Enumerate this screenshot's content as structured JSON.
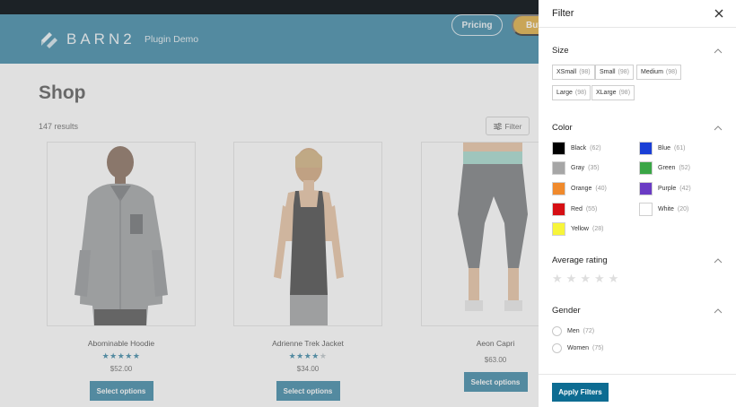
{
  "header": {
    "logo_text": "BARN2",
    "subtitle": "Plugin Demo",
    "pricing_label": "Pricing",
    "buy_label": "Buy"
  },
  "shop": {
    "title": "Shop",
    "results": "147 results",
    "filter_label": "Filter"
  },
  "products": [
    {
      "name": "Abominable Hoodie",
      "rating": 5,
      "price": "$52.00",
      "button": "Select options"
    },
    {
      "name": "Adrienne Trek Jacket",
      "rating": 4,
      "price": "$34.00",
      "button": "Select options"
    },
    {
      "name": "Aeon Capri",
      "rating": 0,
      "price": "$63.00",
      "button": "Select options"
    }
  ],
  "filter_drawer": {
    "title": "Filter",
    "size": {
      "title": "Size",
      "options": [
        {
          "label": "XSmall",
          "count": "(98)"
        },
        {
          "label": "Small",
          "count": "(98)"
        },
        {
          "label": "Medium",
          "count": "(98)"
        },
        {
          "label": "Large",
          "count": "(98)"
        },
        {
          "label": "XLarge",
          "count": "(98)"
        }
      ]
    },
    "color": {
      "title": "Color",
      "options": [
        {
          "label": "Black",
          "count": "(62)",
          "hex": "#000000"
        },
        {
          "label": "Blue",
          "count": "(61)",
          "hex": "#1a3fd6"
        },
        {
          "label": "Gray",
          "count": "(35)",
          "hex": "#a6a6a6"
        },
        {
          "label": "Green",
          "count": "(52)",
          "hex": "#3aa646"
        },
        {
          "label": "Orange",
          "count": "(40)",
          "hex": "#f08a2c"
        },
        {
          "label": "Purple",
          "count": "(42)",
          "hex": "#6a3bc4"
        },
        {
          "label": "Red",
          "count": "(55)",
          "hex": "#d60f14"
        },
        {
          "label": "White",
          "count": "(20)",
          "hex": "#ffffff"
        },
        {
          "label": "Yellow",
          "count": "(28)",
          "hex": "#f7f53a"
        }
      ]
    },
    "rating": {
      "title": "Average rating"
    },
    "gender": {
      "title": "Gender",
      "options": [
        {
          "label": "Men",
          "count": "(72)"
        },
        {
          "label": "Women",
          "count": "(75)"
        }
      ]
    },
    "apply_label": "Apply Filters"
  },
  "colors": {
    "brand": "#0d6c92",
    "buy": "#d89a14",
    "topbar": "#1c2226"
  }
}
